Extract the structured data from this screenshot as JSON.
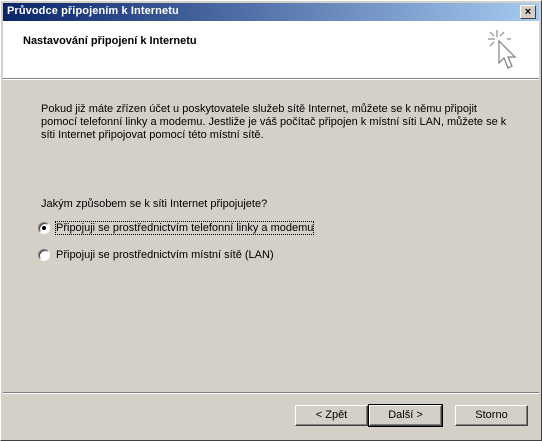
{
  "window": {
    "title": "Průvodce připojením k Internetu",
    "close_glyph": "×"
  },
  "header": {
    "title": "Nastavování připojení k Internetu",
    "icon": "wizard-cursor-icon"
  },
  "body": {
    "description": "Pokud již máte zřízen účet u poskytovatele služeb sítě Internet, můžete se k němu připojit pomocí telefonní linky a modemu. Jestliže je váš počítač připojen k místní síti LAN, můžete se k síti Internet připojovat pomocí této místní sítě.",
    "question": "Jakým způsobem se k síti Internet připojujete?",
    "options": [
      {
        "label": "Připojuji se prostřednictvím telefonní linky a modemu",
        "selected": true
      },
      {
        "label": "Připojuji se prostřednictvím místní sítě (LAN)",
        "selected": false
      }
    ]
  },
  "footer": {
    "back_label": "< Zpět",
    "next_label": "Další >",
    "cancel_label": "Storno"
  }
}
